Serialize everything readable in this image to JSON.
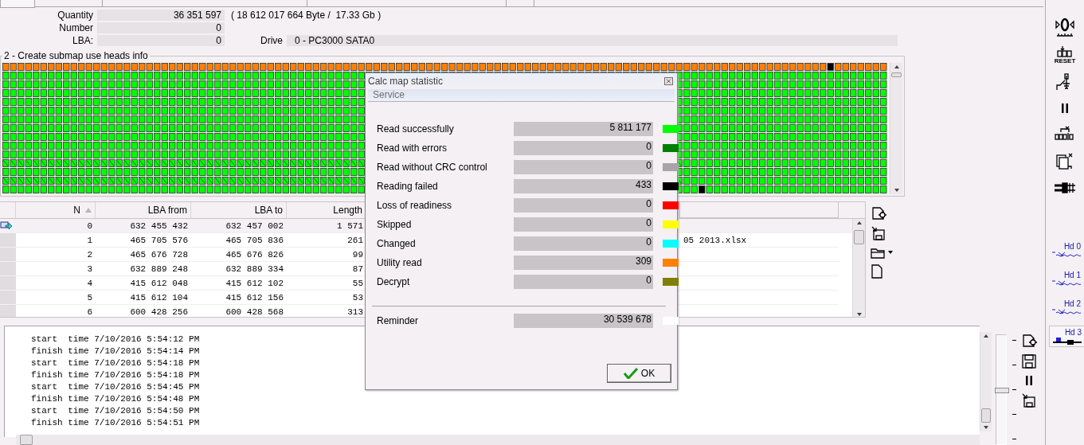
{
  "info": {
    "rows": [
      {
        "label": "Quantity",
        "value": "36 351 597",
        "note": "( 18 612 017 664 Byte /  17.33 Gb )"
      },
      {
        "label": "Number",
        "value": "0"
      },
      {
        "label": "LBA:",
        "value": "0"
      }
    ],
    "drive": {
      "label": "Drive",
      "value": "0 - PC3000 SATA0"
    }
  },
  "map": {
    "title": "2 - Create submap use heads info"
  },
  "table": {
    "columns": [
      "N",
      "LBA from",
      "LBA to",
      "Length"
    ],
    "rows": [
      {
        "current": true,
        "cells": [
          "0",
          "632 455 432",
          "632 457 002",
          "1 571"
        ]
      },
      {
        "current": false,
        "cells": [
          "1",
          "465 705 576",
          "465 705 836",
          "261"
        ],
        "column_6": "05 2013.xlsx"
      },
      {
        "current": false,
        "cells": [
          "2",
          "465 676 728",
          "465 676 826",
          "99"
        ]
      },
      {
        "current": false,
        "cells": [
          "3",
          "632 889 248",
          "632 889 334",
          "87"
        ]
      },
      {
        "current": false,
        "cells": [
          "4",
          "415 612 048",
          "415 612 102",
          "55"
        ]
      },
      {
        "current": false,
        "cells": [
          "5",
          "415 612 104",
          "415 612 156",
          "53"
        ]
      },
      {
        "current": false,
        "cells": [
          "6",
          "600 428 256",
          "600 428 568",
          "313"
        ]
      }
    ]
  },
  "log": {
    "lines": [
      "start  time 7/10/2016 5:54:12 PM",
      "finish time 7/10/2016 5:54:14 PM",
      "start  time 7/10/2016 5:54:18 PM",
      "finish time 7/10/2016 5:54:18 PM",
      "start  time 7/10/2016 5:54:45 PM",
      "finish time 7/10/2016 5:54:48 PM",
      "start  time 7/10/2016 5:54:50 PM",
      "finish time 7/10/2016 5:54:51 PM"
    ],
    "slider": {
      "level": 0.5
    }
  },
  "sidebar": {
    "tools": [
      {
        "kind": "zero"
      },
      {
        "kind": "reset",
        "label": "RESET"
      },
      {
        "kind": "switch"
      },
      {
        "kind": "pause"
      },
      {
        "kind": "shift"
      },
      {
        "kind": "copy"
      },
      {
        "kind": "connector"
      }
    ],
    "heads": [
      {
        "label": "Hd 0",
        "selected": false
      },
      {
        "label": "Hd 1",
        "selected": false
      },
      {
        "label": "Hd 2",
        "selected": false
      },
      {
        "label": "Hd 3",
        "selected": true
      }
    ]
  },
  "dialog": {
    "title": "Calc map statistic",
    "menu": [
      "Service"
    ],
    "rows": [
      {
        "label": "Read successfully",
        "value": "5 811 177",
        "color": "#00ff00"
      },
      {
        "label": "Read with errors",
        "value": "0",
        "color": "#008000"
      },
      {
        "label": "Read without CRC control",
        "value": "0",
        "color": "#a8a4a8"
      },
      {
        "label": "Reading failed",
        "value": "433",
        "color": "#000000"
      },
      {
        "label": "Loss of readiness",
        "value": "0",
        "color": "#ff0000"
      },
      {
        "label": "Skipped",
        "value": "0",
        "color": "#ffff00"
      },
      {
        "label": "Changed",
        "value": "0",
        "color": "#00ffff"
      },
      {
        "label": "Utility read",
        "value": "309",
        "color": "#ff8000"
      },
      {
        "label": "Decrypt",
        "value": "0",
        "color": "#808000"
      }
    ],
    "reminder": {
      "label": "Reminder",
      "value": "30 539 678",
      "color": "#ffffff"
    },
    "ok": "OK"
  }
}
